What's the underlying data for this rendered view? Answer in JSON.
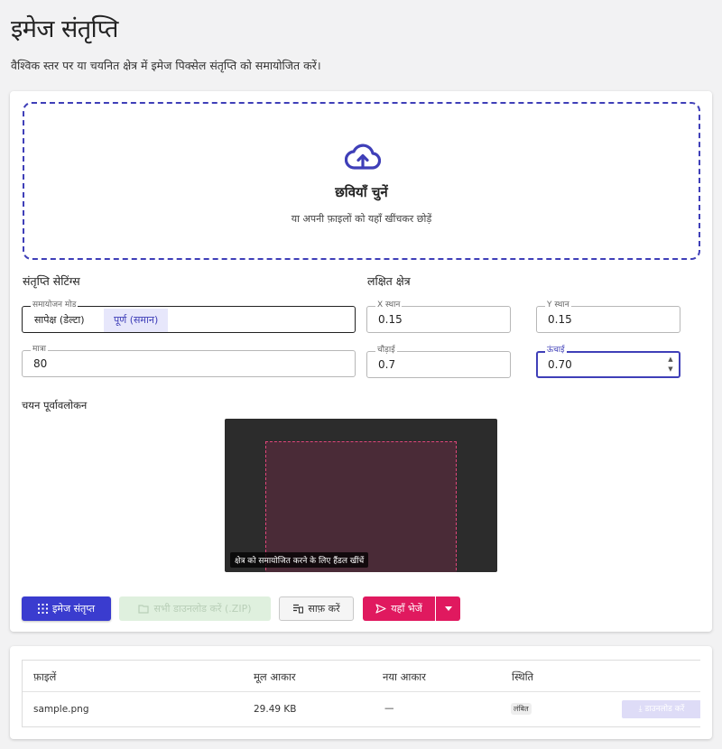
{
  "page": {
    "title": "इमेज संतृप्ति",
    "subtitle": "वैश्विक स्तर पर या चयनित क्षेत्र में इमेज पिक्सेल संतृप्ति को समायोजित करें।"
  },
  "dropzone": {
    "icon": "cloud-upload-icon",
    "title": "छवियाँ चुनें",
    "hint": "या अपनी फ़ाइलों को यहाँ खींचकर छोड़ें"
  },
  "settings": {
    "title": "संतृप्ति सेटिंग्स",
    "mode": {
      "label": "समायोजन मोड",
      "options": [
        "सापेक्ष (डेल्टा)",
        "पूर्ण (समान)"
      ],
      "selected": "पूर्ण (समान)"
    },
    "amount": {
      "label": "मात्रा",
      "value": "80"
    }
  },
  "region": {
    "title": "लक्षित क्षेत्र",
    "x": {
      "label": "X स्थान",
      "value": "0.15"
    },
    "y": {
      "label": "Y स्थान",
      "value": "0.15"
    },
    "width": {
      "label": "चौड़ाई",
      "value": "0.7"
    },
    "height": {
      "label": "ऊंचाई",
      "value": "0.70"
    }
  },
  "preview": {
    "title": "चयन पूर्वावलोकन",
    "hint": "क्षेत्र को समायोजित करने के लिए हैंडल खींचें"
  },
  "actions": {
    "saturate": "इमेज संतृप्त",
    "download_all": "सभी डाउनलोड करें (.ZIP)",
    "clear": "साफ़ करें",
    "send": "यहाँ भेजें"
  },
  "files": {
    "columns": [
      "फ़ाइलें",
      "मूल आकार",
      "नया आकार",
      "स्थिति"
    ],
    "rows": [
      {
        "name": "sample.png",
        "original_size": "29.49 KB",
        "new_size": "—",
        "status": "लंबित",
        "action": "डाउनलोड करें"
      }
    ]
  },
  "colors": {
    "primary": "#3a3ccf",
    "accent_pink": "#e0195f",
    "selection_border": "#e0457a"
  }
}
